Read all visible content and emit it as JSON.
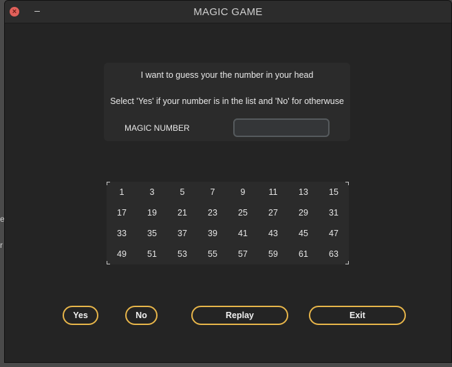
{
  "window": {
    "title": "MAGIC GAME",
    "minimize_glyph": "–",
    "close_glyph": "×"
  },
  "info": {
    "line1": "I want to guess your the number in your head",
    "line2": "Select 'Yes' if your number is in the list and 'No' for otherwuse",
    "magic_label": "MAGIC NUMBER",
    "magic_value": ""
  },
  "numbers": [
    [
      "1",
      "3",
      "5",
      "7",
      "9",
      "11",
      "13",
      "15"
    ],
    [
      "17",
      "19",
      "21",
      "23",
      "25",
      "27",
      "29",
      "31"
    ],
    [
      "33",
      "35",
      "37",
      "39",
      "41",
      "43",
      "45",
      "47"
    ],
    [
      "49",
      "51",
      "53",
      "55",
      "57",
      "59",
      "61",
      "63"
    ]
  ],
  "buttons": {
    "yes": "Yes",
    "no": "No",
    "replay": "Replay",
    "exit": "Exit"
  },
  "background_text": {
    "a": "e",
    "b": "r"
  },
  "colors": {
    "button_border": "#e8b64a",
    "window_bg": "#242424",
    "panel_bg": "#2b2b2b",
    "close_button": "#e0605a"
  }
}
